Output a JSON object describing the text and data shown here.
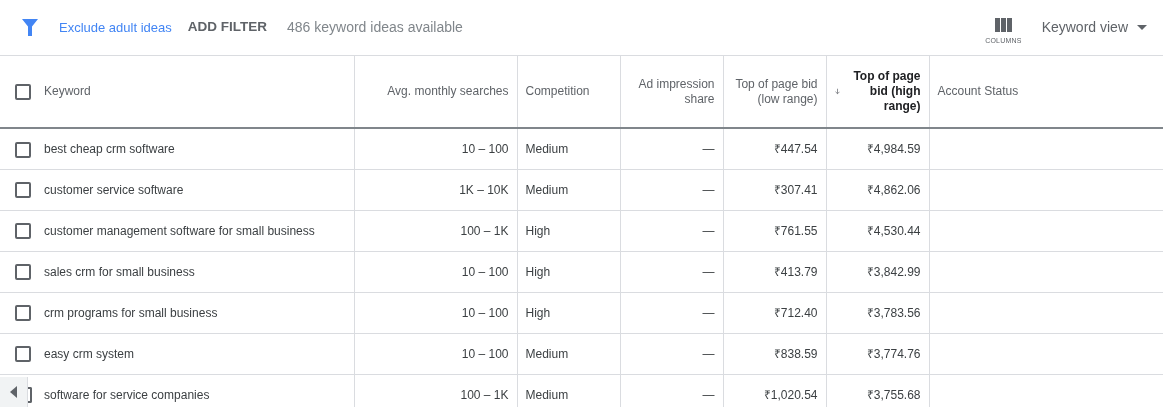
{
  "toolbar": {
    "filter_link": "Exclude adult ideas",
    "add_filter": "ADD FILTER",
    "count": "486 keyword ideas available",
    "columns_label": "COLUMNS",
    "view_menu": "Keyword view"
  },
  "table": {
    "select_all_checked": false,
    "columns": [
      {
        "label": "Keyword",
        "sorted": false
      },
      {
        "label": "Avg. monthly searches",
        "sorted": false
      },
      {
        "label": "Competition",
        "sorted": false
      },
      {
        "label": "Ad impression share",
        "sorted": false
      },
      {
        "label": "Top of page bid (low range)",
        "sorted": false
      },
      {
        "label": "Top of page bid (high range)",
        "sorted": true
      },
      {
        "label": "Account Status",
        "sorted": false
      }
    ],
    "rows": [
      {
        "checked": false,
        "cells": [
          "best cheap crm software",
          "10 – 100",
          "Medium",
          "—",
          "₹447.54",
          "₹4,984.59"
        ]
      },
      {
        "checked": false,
        "cells": [
          "customer service software",
          "1K – 10K",
          "Medium",
          "—",
          "₹307.41",
          "₹4,862.06"
        ]
      },
      {
        "checked": false,
        "cells": [
          "customer management software for small business",
          "100 – 1K",
          "High",
          "—",
          "₹761.55",
          "₹4,530.44"
        ]
      },
      {
        "checked": false,
        "cells": [
          "sales crm for small business",
          "10 – 100",
          "High",
          "—",
          "₹413.79",
          "₹3,842.99"
        ]
      },
      {
        "checked": false,
        "cells": [
          "crm programs for small business",
          "10 – 100",
          "High",
          "—",
          "₹712.40",
          "₹3,783.56"
        ]
      },
      {
        "checked": false,
        "cells": [
          "easy crm system",
          "10 – 100",
          "Medium",
          "—",
          "₹838.59",
          "₹3,774.76"
        ]
      },
      {
        "checked": false,
        "cells": [
          "software for service companies",
          "100 – 1K",
          "Medium",
          "—",
          "₹1,020.54",
          "₹3,755.68"
        ]
      }
    ]
  }
}
